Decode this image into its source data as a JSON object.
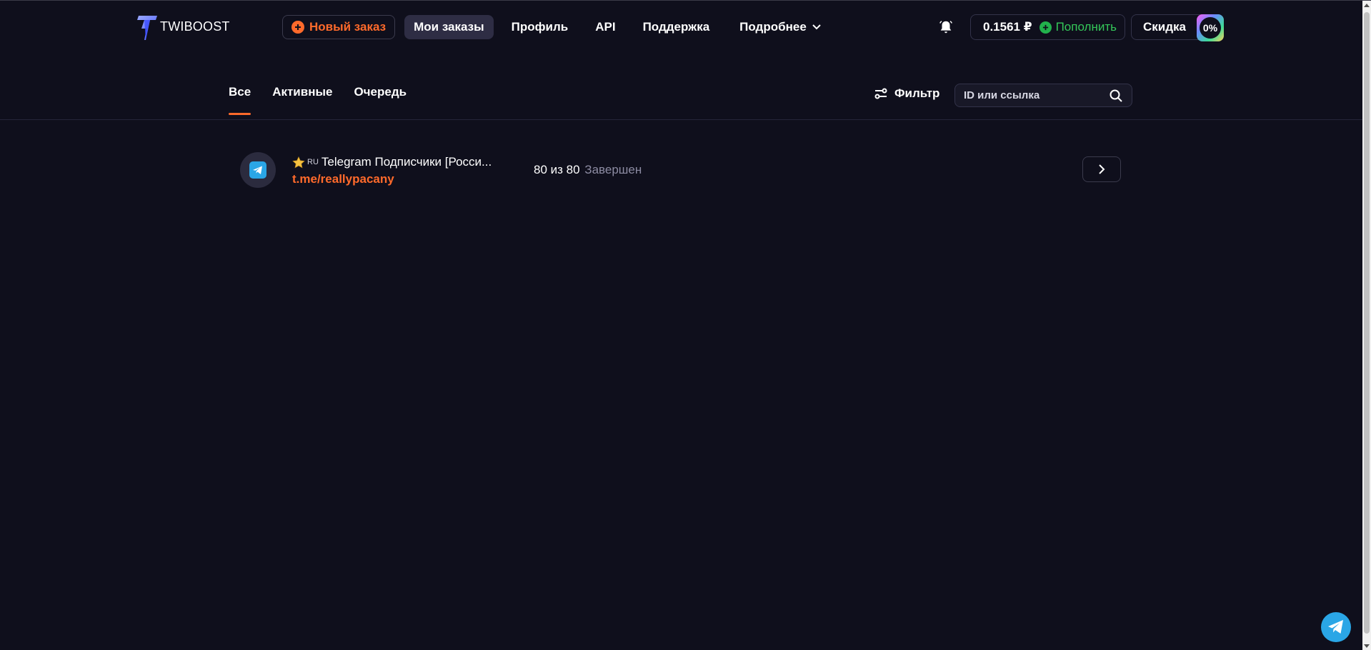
{
  "header": {
    "logo_text": "TWIBOOST",
    "new_order_label": "Новый заказ",
    "nav": [
      {
        "label": "Мои заказы",
        "active": true
      },
      {
        "label": "Профиль"
      },
      {
        "label": "API"
      },
      {
        "label": "Поддержка"
      },
      {
        "label": "Подробнее"
      }
    ],
    "balance": "0.1561 ₽",
    "topup_label": "Пополнить",
    "discount_label": "Скидка",
    "discount_value": "0%"
  },
  "tabs": [
    {
      "label": "Все",
      "active": true
    },
    {
      "label": "Активные"
    },
    {
      "label": "Очередь"
    }
  ],
  "filter_label": "Фильтр",
  "search": {
    "placeholder": "ID или ссылка",
    "value": ""
  },
  "orders": [
    {
      "badge": "RU",
      "title": "Telegram Подписчики [Росси...",
      "link": "t.me/reallypacany",
      "progress": "80 из 80",
      "status": "Завершен"
    }
  ],
  "colors": {
    "background": "#0f0f1c",
    "accent": "#ff6a2b",
    "topup": "#34c759",
    "telegram": "#2aa6e6"
  },
  "icons": [
    "logo-bolt-icon",
    "plus-circle-icon",
    "chevron-down-icon",
    "bell-icon",
    "filter-icon",
    "search-icon",
    "star-icon",
    "telegram-icon",
    "chevron-right-icon"
  ]
}
